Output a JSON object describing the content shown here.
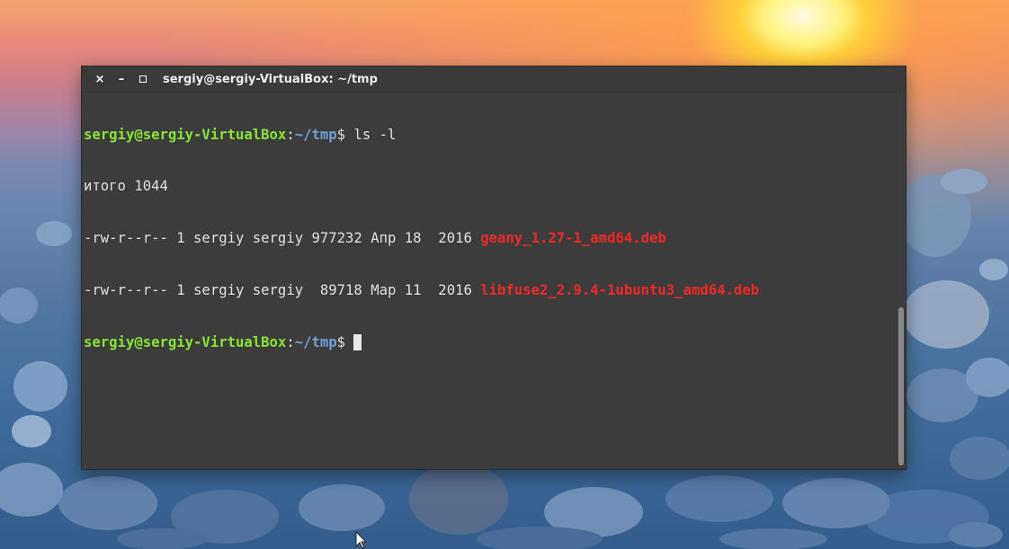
{
  "window": {
    "title": "sergiy@sergiy-VirtualBox: ~/tmp",
    "buttons": {
      "close": "×",
      "minimize": "–"
    }
  },
  "terminal": {
    "prompt": {
      "user_host": "sergiy@sergiy-VirtualBox",
      "colon": ":",
      "path": "~/tmp",
      "symbol": "$ "
    },
    "command": "ls -l",
    "total_line": "итого 1044",
    "files": [
      {
        "prefix": "-rw-r--r-- 1 sergiy sergiy 977232 Апр 18  2016 ",
        "name": "geany_1.27-1_amd64.deb"
      },
      {
        "prefix": "-rw-r--r-- 1 sergiy sergiy  89718 Мар 11  2016 ",
        "name": "libfuse2_2.9.4-1ubuntu3_amd64.deb"
      }
    ]
  },
  "icons": {
    "close": "close-icon",
    "minimize": "minimize-icon",
    "maximize": "maximize-icon",
    "pointer": "mouse-pointer-icon"
  },
  "colors": {
    "prompt_user": "#8ae234",
    "prompt_path": "#729fcf",
    "archive_file": "#ef2929",
    "terminal_bg": "#3c3c3c",
    "text": "#e0e0e0"
  }
}
